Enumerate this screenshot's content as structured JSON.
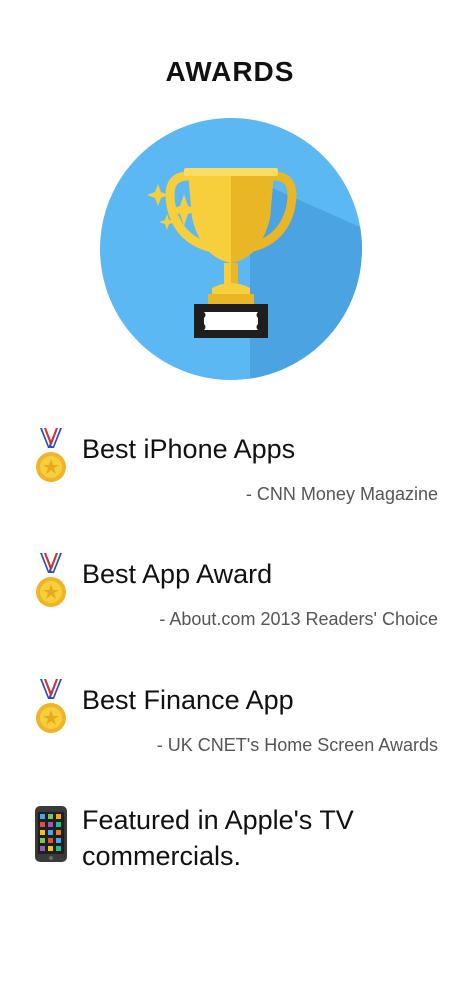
{
  "page": {
    "title": "AWARDS"
  },
  "illustration": {
    "icon": "trophy-icon",
    "circle_color": "#5bb8f3",
    "trophy_color": "#f7ce3b"
  },
  "awards": [
    {
      "icon": "medal-icon",
      "title": "Best iPhone Apps",
      "source": "- CNN Money Magazine"
    },
    {
      "icon": "medal-icon",
      "title": "Best App Award",
      "source": "- About.com 2013 Readers' Choice"
    },
    {
      "icon": "medal-icon",
      "title": "Best Finance App",
      "source": "- UK CNET's Home Screen Awards"
    }
  ],
  "featured": {
    "icon": "mobile-phone-icon",
    "title": "Featured in Apple's TV commercials."
  }
}
